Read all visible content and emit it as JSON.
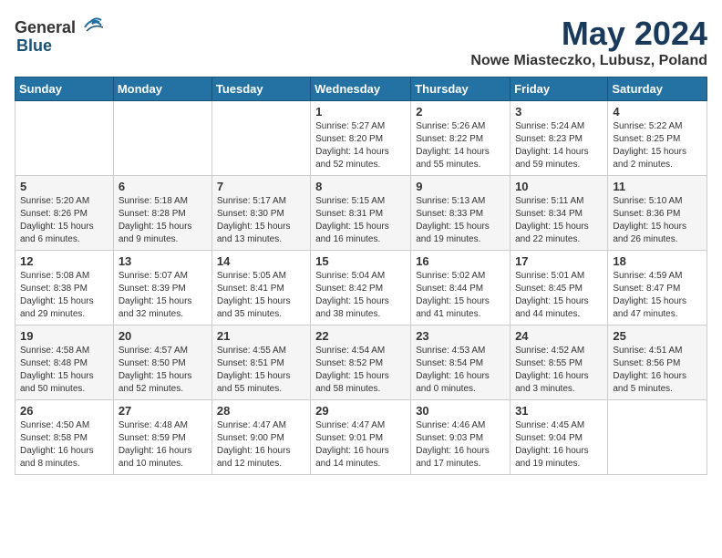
{
  "logo": {
    "general": "General",
    "blue": "Blue"
  },
  "title": {
    "month": "May 2024",
    "location": "Nowe Miasteczko, Lubusz, Poland"
  },
  "weekdays": [
    "Sunday",
    "Monday",
    "Tuesday",
    "Wednesday",
    "Thursday",
    "Friday",
    "Saturday"
  ],
  "weeks": [
    [
      {
        "day": "",
        "info": ""
      },
      {
        "day": "",
        "info": ""
      },
      {
        "day": "",
        "info": ""
      },
      {
        "day": "1",
        "info": "Sunrise: 5:27 AM\nSunset: 8:20 PM\nDaylight: 14 hours and 52 minutes."
      },
      {
        "day": "2",
        "info": "Sunrise: 5:26 AM\nSunset: 8:22 PM\nDaylight: 14 hours and 55 minutes."
      },
      {
        "day": "3",
        "info": "Sunrise: 5:24 AM\nSunset: 8:23 PM\nDaylight: 14 hours and 59 minutes."
      },
      {
        "day": "4",
        "info": "Sunrise: 5:22 AM\nSunset: 8:25 PM\nDaylight: 15 hours and 2 minutes."
      }
    ],
    [
      {
        "day": "5",
        "info": "Sunrise: 5:20 AM\nSunset: 8:26 PM\nDaylight: 15 hours and 6 minutes."
      },
      {
        "day": "6",
        "info": "Sunrise: 5:18 AM\nSunset: 8:28 PM\nDaylight: 15 hours and 9 minutes."
      },
      {
        "day": "7",
        "info": "Sunrise: 5:17 AM\nSunset: 8:30 PM\nDaylight: 15 hours and 13 minutes."
      },
      {
        "day": "8",
        "info": "Sunrise: 5:15 AM\nSunset: 8:31 PM\nDaylight: 15 hours and 16 minutes."
      },
      {
        "day": "9",
        "info": "Sunrise: 5:13 AM\nSunset: 8:33 PM\nDaylight: 15 hours and 19 minutes."
      },
      {
        "day": "10",
        "info": "Sunrise: 5:11 AM\nSunset: 8:34 PM\nDaylight: 15 hours and 22 minutes."
      },
      {
        "day": "11",
        "info": "Sunrise: 5:10 AM\nSunset: 8:36 PM\nDaylight: 15 hours and 26 minutes."
      }
    ],
    [
      {
        "day": "12",
        "info": "Sunrise: 5:08 AM\nSunset: 8:38 PM\nDaylight: 15 hours and 29 minutes."
      },
      {
        "day": "13",
        "info": "Sunrise: 5:07 AM\nSunset: 8:39 PM\nDaylight: 15 hours and 32 minutes."
      },
      {
        "day": "14",
        "info": "Sunrise: 5:05 AM\nSunset: 8:41 PM\nDaylight: 15 hours and 35 minutes."
      },
      {
        "day": "15",
        "info": "Sunrise: 5:04 AM\nSunset: 8:42 PM\nDaylight: 15 hours and 38 minutes."
      },
      {
        "day": "16",
        "info": "Sunrise: 5:02 AM\nSunset: 8:44 PM\nDaylight: 15 hours and 41 minutes."
      },
      {
        "day": "17",
        "info": "Sunrise: 5:01 AM\nSunset: 8:45 PM\nDaylight: 15 hours and 44 minutes."
      },
      {
        "day": "18",
        "info": "Sunrise: 4:59 AM\nSunset: 8:47 PM\nDaylight: 15 hours and 47 minutes."
      }
    ],
    [
      {
        "day": "19",
        "info": "Sunrise: 4:58 AM\nSunset: 8:48 PM\nDaylight: 15 hours and 50 minutes."
      },
      {
        "day": "20",
        "info": "Sunrise: 4:57 AM\nSunset: 8:50 PM\nDaylight: 15 hours and 52 minutes."
      },
      {
        "day": "21",
        "info": "Sunrise: 4:55 AM\nSunset: 8:51 PM\nDaylight: 15 hours and 55 minutes."
      },
      {
        "day": "22",
        "info": "Sunrise: 4:54 AM\nSunset: 8:52 PM\nDaylight: 15 hours and 58 minutes."
      },
      {
        "day": "23",
        "info": "Sunrise: 4:53 AM\nSunset: 8:54 PM\nDaylight: 16 hours and 0 minutes."
      },
      {
        "day": "24",
        "info": "Sunrise: 4:52 AM\nSunset: 8:55 PM\nDaylight: 16 hours and 3 minutes."
      },
      {
        "day": "25",
        "info": "Sunrise: 4:51 AM\nSunset: 8:56 PM\nDaylight: 16 hours and 5 minutes."
      }
    ],
    [
      {
        "day": "26",
        "info": "Sunrise: 4:50 AM\nSunset: 8:58 PM\nDaylight: 16 hours and 8 minutes."
      },
      {
        "day": "27",
        "info": "Sunrise: 4:48 AM\nSunset: 8:59 PM\nDaylight: 16 hours and 10 minutes."
      },
      {
        "day": "28",
        "info": "Sunrise: 4:47 AM\nSunset: 9:00 PM\nDaylight: 16 hours and 12 minutes."
      },
      {
        "day": "29",
        "info": "Sunrise: 4:47 AM\nSunset: 9:01 PM\nDaylight: 16 hours and 14 minutes."
      },
      {
        "day": "30",
        "info": "Sunrise: 4:46 AM\nSunset: 9:03 PM\nDaylight: 16 hours and 17 minutes."
      },
      {
        "day": "31",
        "info": "Sunrise: 4:45 AM\nSunset: 9:04 PM\nDaylight: 16 hours and 19 minutes."
      },
      {
        "day": "",
        "info": ""
      }
    ]
  ]
}
